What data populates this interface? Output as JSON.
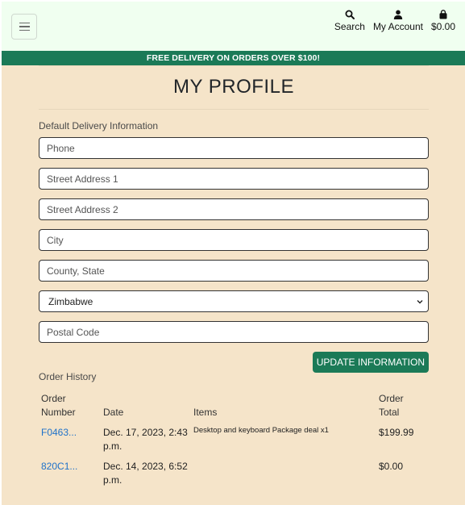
{
  "nav": {
    "search_label": "Search",
    "account_label": "My Account",
    "cart_total": "$0.00"
  },
  "banner": {
    "text": "FREE DELIVERY ON ORDERS OVER $100!"
  },
  "page": {
    "title": "MY PROFILE"
  },
  "delivery": {
    "heading": "Default Delivery Information",
    "phone_placeholder": "Phone",
    "street1_placeholder": "Street Address 1",
    "street2_placeholder": "Street Address 2",
    "city_placeholder": "City",
    "county_placeholder": "County, State",
    "country_value": "Zimbabwe",
    "postal_placeholder": "Postal Code",
    "update_button": "UPDATE INFORMATION"
  },
  "orders": {
    "heading": "Order History",
    "columns": [
      "Order Number",
      "Date",
      "Items",
      "Order Total"
    ],
    "rows": [
      {
        "number": "F0463...",
        "date": "Dec. 17, 2023, 2:43 p.m.",
        "items": "Desktop and keyboard Package deal x1",
        "total": "$199.99"
      },
      {
        "number": "820C1...",
        "date": "Dec. 14, 2023, 6:52 p.m.",
        "items": "",
        "total": "$0.00"
      }
    ]
  }
}
